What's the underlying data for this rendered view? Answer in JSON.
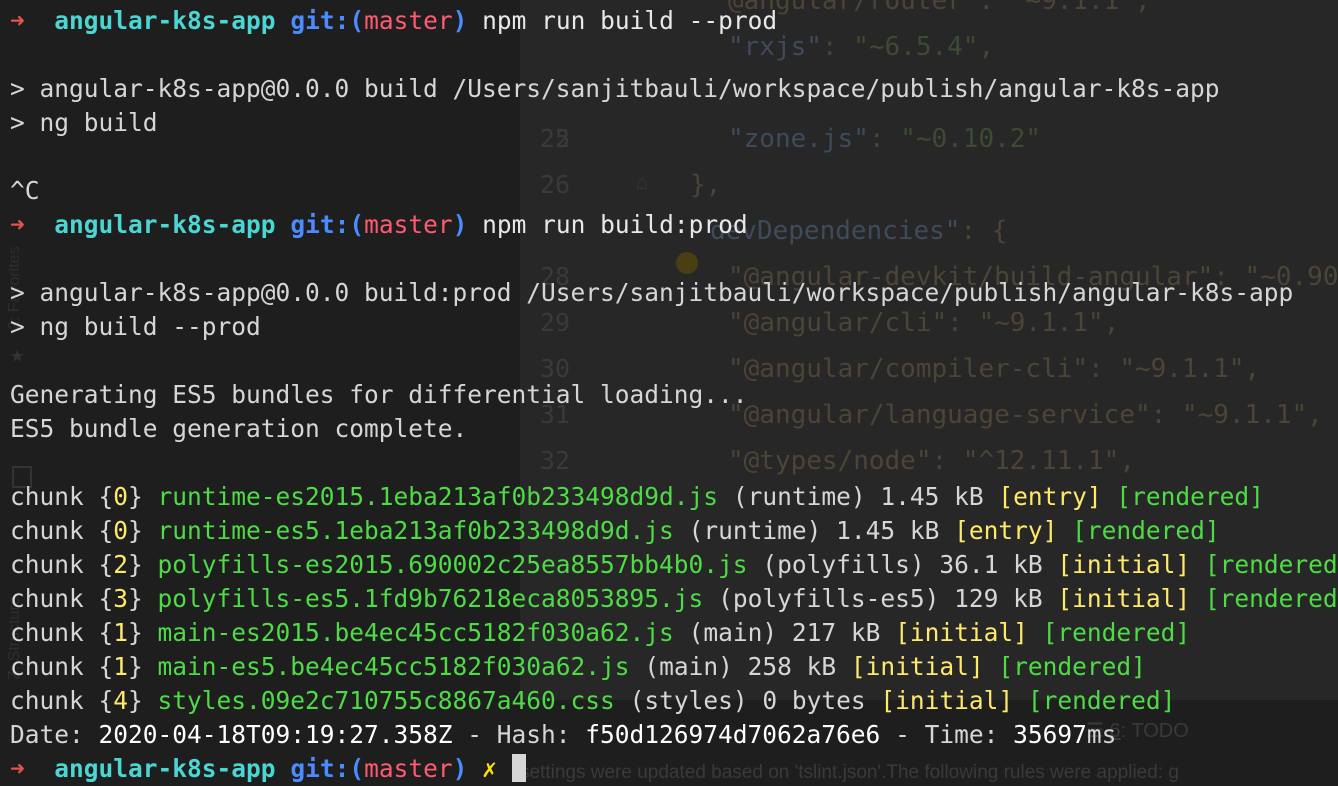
{
  "ide": {
    "gutter": [
      "22",
      "25",
      "26",
      "28",
      "29",
      "30",
      "31",
      "32"
    ],
    "code": {
      "l1": "@angular/router\": \"~9.1.1\",",
      "l2_key": "\"rxjs\"",
      "l2_val": ": \"~6.5.4\",",
      "l3_key": "\"zone.js\"",
      "l3_val": ": \"~0.10.2\"",
      "l4": "},",
      "l5_key": "devDependencies\"",
      "l5_val": ": {",
      "l6": "\"@angular-devkit/build-angular\": \"~0.90",
      "l7": "\"@angular/cli\": \"~9.1.1\",",
      "l8": "\"@angular/compiler-cli\": \"~9.1.1\",",
      "l9": "\"@angular/language-service\": \"~9.1.1\",",
      "l10": "\"@types/node\": \"^12.11.1\","
    },
    "sidebar": {
      "favorites": "2: Favorites",
      "structure": "Z: Structure"
    },
    "bottom_bar": {
      "todo_num": "6",
      "todo_label": ": TODO"
    },
    "status_message": "settings were updated based on 'tslint.json'.The following rules were applied: g"
  },
  "terminal": {
    "prompt": {
      "arrow": "➜",
      "dir": "angular-k8s-app",
      "git": "git:(",
      "branch": "master",
      "close": ")"
    },
    "lines": {
      "cmd1": "npm run build --prod",
      "out1a": "> angular-k8s-app@0.0.0 build /Users/sanjitbauli/workspace/publish/angular-k8s-app",
      "out1b": "> ng build",
      "interrupt": "^C",
      "cmd2": "npm run build:prod",
      "out2a": "> angular-k8s-app@0.0.0 build:prod /Users/sanjitbauli/workspace/publish/angular-k8s-app",
      "out2b": "> ng build --prod",
      "gen1": "Generating ES5 bundles for differential loading...",
      "gen2": "ES5 bundle generation complete."
    },
    "chunks": [
      {
        "id": "0",
        "file": "runtime-es2015.1eba213af0b233498d9d.js",
        "meta": "(runtime) 1.45 kB",
        "tag": "[entry]",
        "status": "[rendered]"
      },
      {
        "id": "0",
        "file": "runtime-es5.1eba213af0b233498d9d.js",
        "meta": "(runtime) 1.45 kB",
        "tag": "[entry]",
        "status": "[rendered]"
      },
      {
        "id": "2",
        "file": "polyfills-es2015.690002c25ea8557bb4b0.js",
        "meta": "(polyfills) 36.1 kB",
        "tag": "[initial]",
        "status": "[rendered]"
      },
      {
        "id": "3",
        "file": "polyfills-es5.1fd9b76218eca8053895.js",
        "meta": "(polyfills-es5) 129 kB",
        "tag": "[initial]",
        "status": "[rendered]"
      },
      {
        "id": "1",
        "file": "main-es2015.be4ec45cc5182f030a62.js",
        "meta": "(main) 217 kB",
        "tag": "[initial]",
        "status": "[rendered]"
      },
      {
        "id": "1",
        "file": "main-es5.be4ec45cc5182f030a62.js",
        "meta": "(main) 258 kB",
        "tag": "[initial]",
        "status": "[rendered]"
      },
      {
        "id": "4",
        "file": "styles.09e2c710755c8867a460.css",
        "meta": "(styles) 0 bytes",
        "tag": "[initial]",
        "status": "[rendered]"
      }
    ],
    "summary": {
      "date_label": "Date: ",
      "date": "2020-04-18T09:19:27.358Z",
      "hash_label": " - Hash: ",
      "hash": "f50d126974d7062a76e6",
      "time_label": " - Time: ",
      "time": "35697",
      "time_unit": "ms"
    },
    "final_prompt_dirty": "✗"
  }
}
